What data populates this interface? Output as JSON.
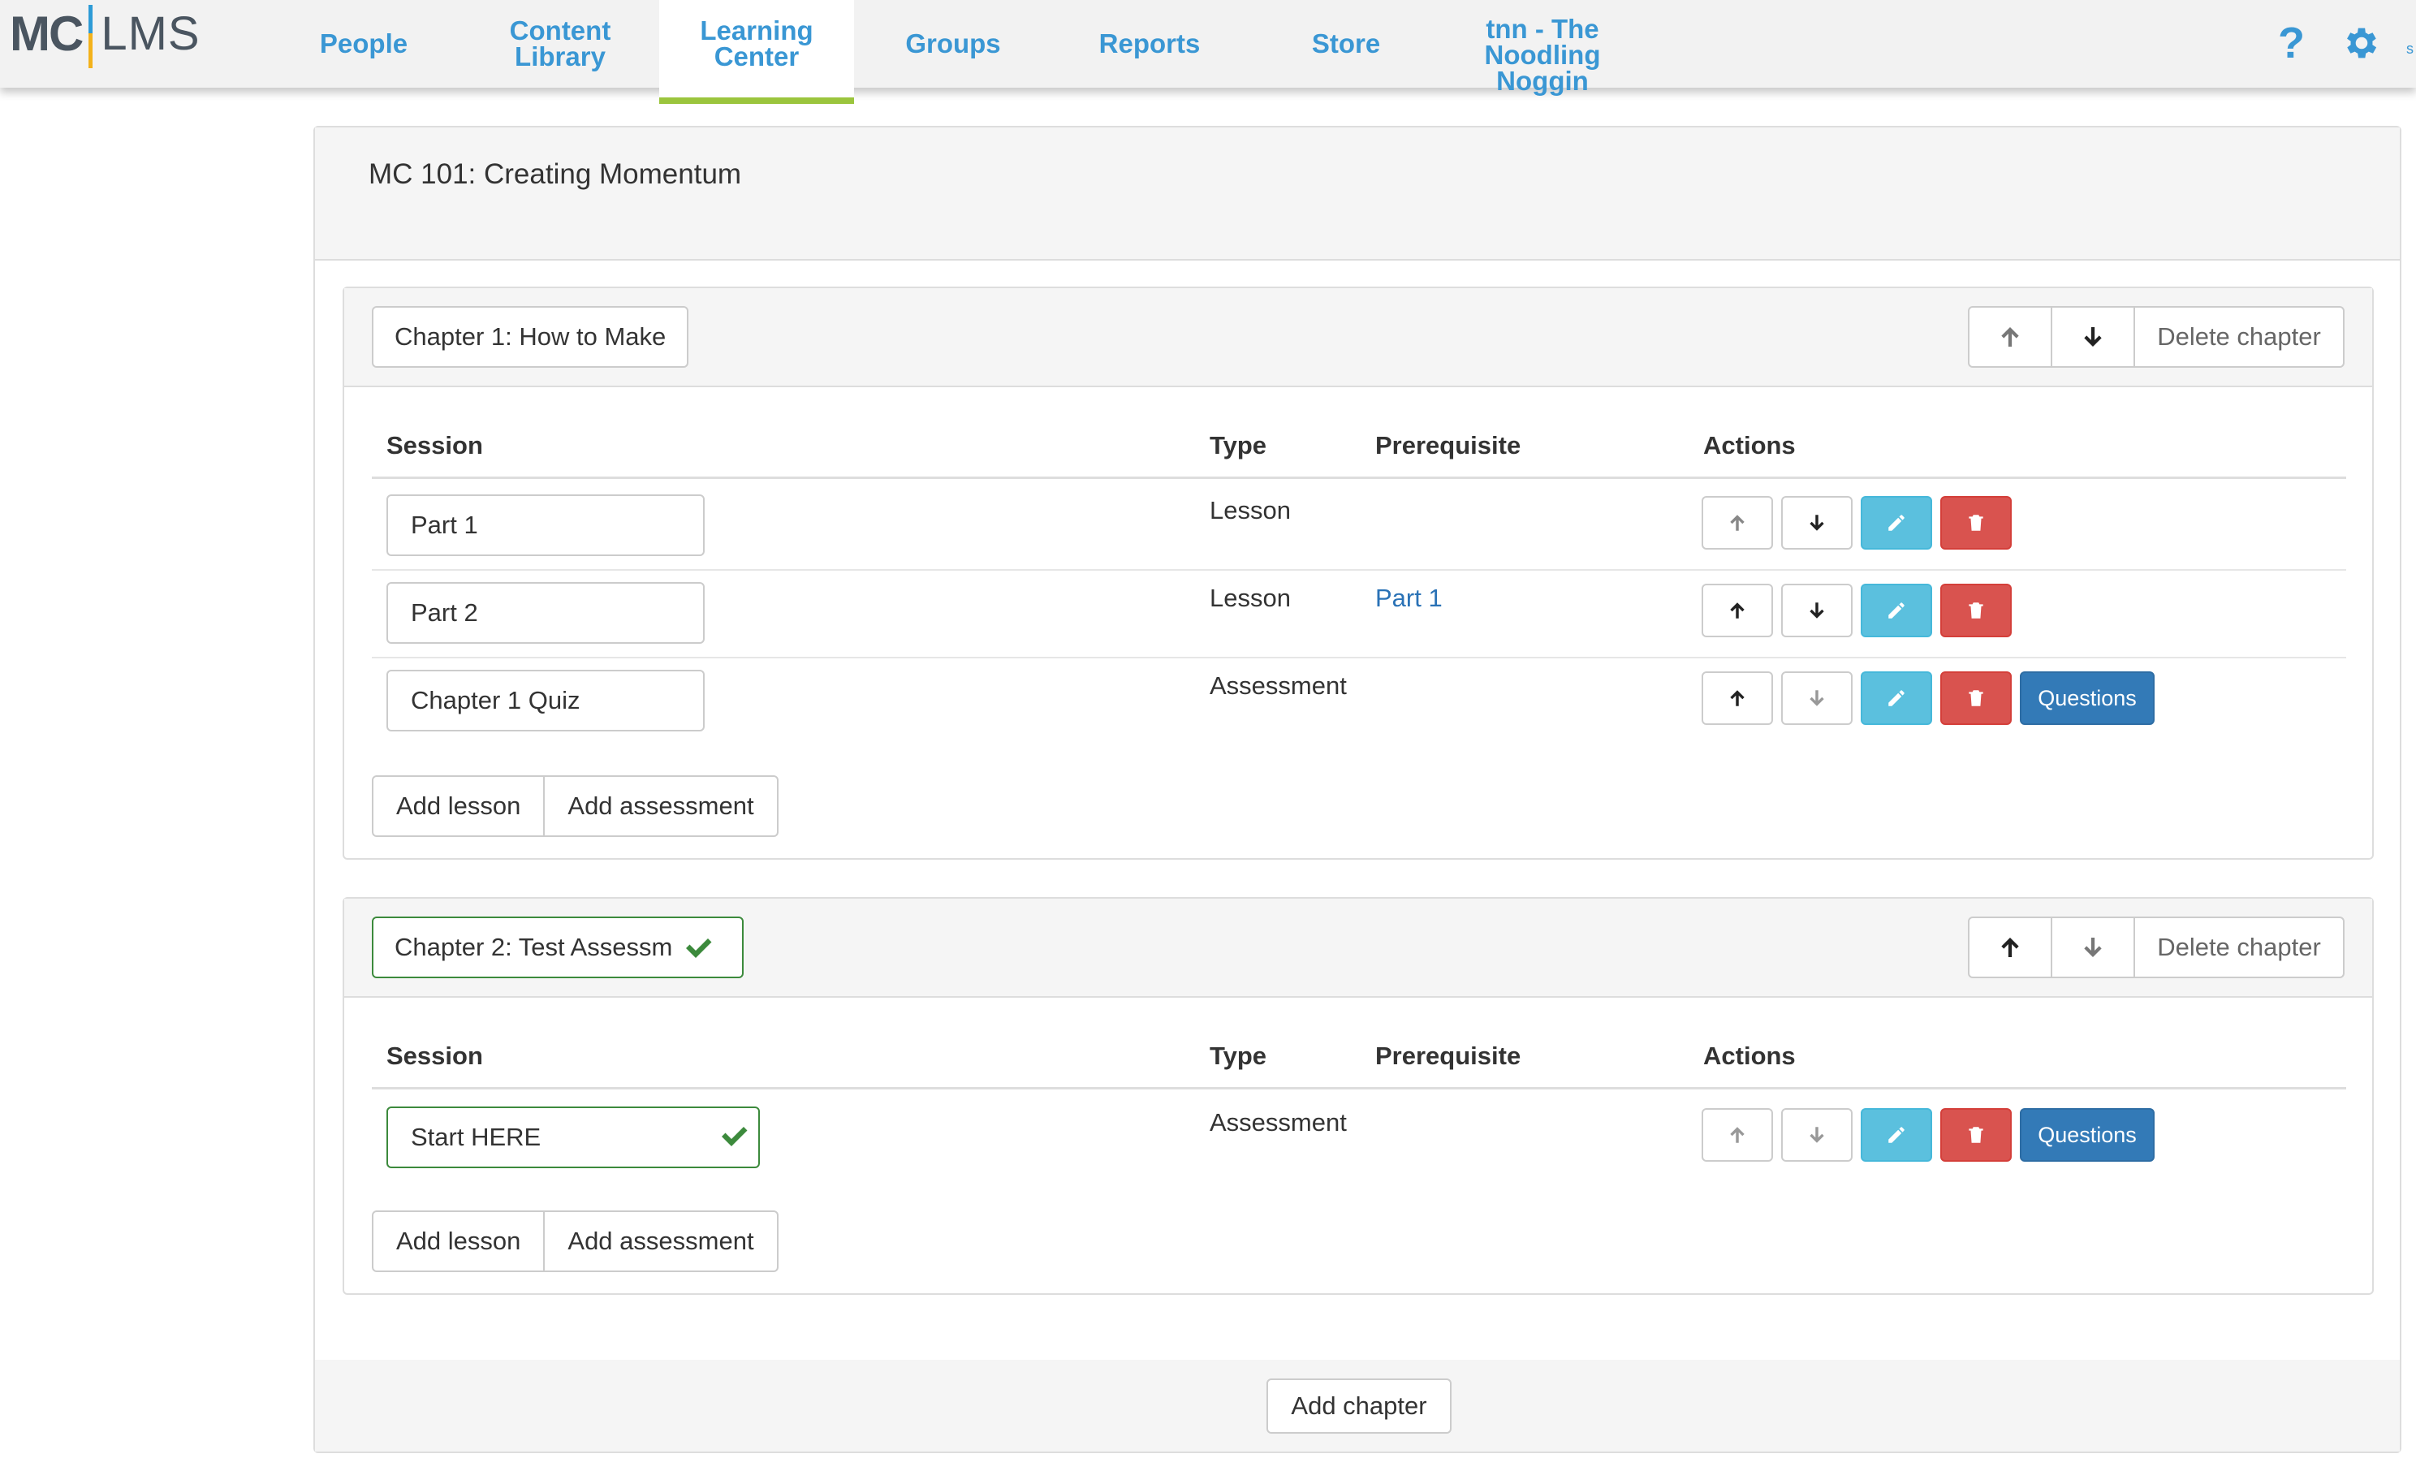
{
  "app": {
    "logo_left": "MC",
    "logo_right": "LMS"
  },
  "nav": {
    "people": "People",
    "content_library": [
      "Content",
      "Library"
    ],
    "learning_center": [
      "Learning",
      "Center"
    ],
    "groups": "Groups",
    "reports": "Reports",
    "store": "Store",
    "org": [
      "tnn - The",
      "Noodling",
      "Noggin"
    ],
    "help": "?",
    "user_fragment": "s"
  },
  "course": {
    "title": "MC 101: Creating Momentum"
  },
  "columns": {
    "session": "Session",
    "type": "Type",
    "prerequisite": "Prerequisite",
    "actions": "Actions"
  },
  "labels": {
    "delete_chapter": "Delete chapter",
    "add_lesson": "Add lesson",
    "add_assessment": "Add assessment",
    "questions": "Questions",
    "add_chapter": "Add chapter"
  },
  "chapters": [
    {
      "title": "Chapter 1: How to Make",
      "sessions": [
        {
          "name": "Part 1",
          "type": "Lesson",
          "prerequisite": ""
        },
        {
          "name": "Part 2",
          "type": "Lesson",
          "prerequisite": "Part 1"
        },
        {
          "name": "Chapter 1 Quiz",
          "type": "Assessment",
          "prerequisite": ""
        }
      ]
    },
    {
      "title": "Chapter 2: Test Assessm",
      "sessions": [
        {
          "name": "Start HERE",
          "type": "Assessment",
          "prerequisite": ""
        }
      ]
    }
  ],
  "colors": {
    "nav_text": "#3a97d4",
    "active_underline": "#9bc53d",
    "edit_button": "#5bc0de",
    "delete_button": "#d9534f",
    "questions_button": "#337ab7",
    "valid_border": "#3c8a3c",
    "link": "#2a72b6"
  }
}
